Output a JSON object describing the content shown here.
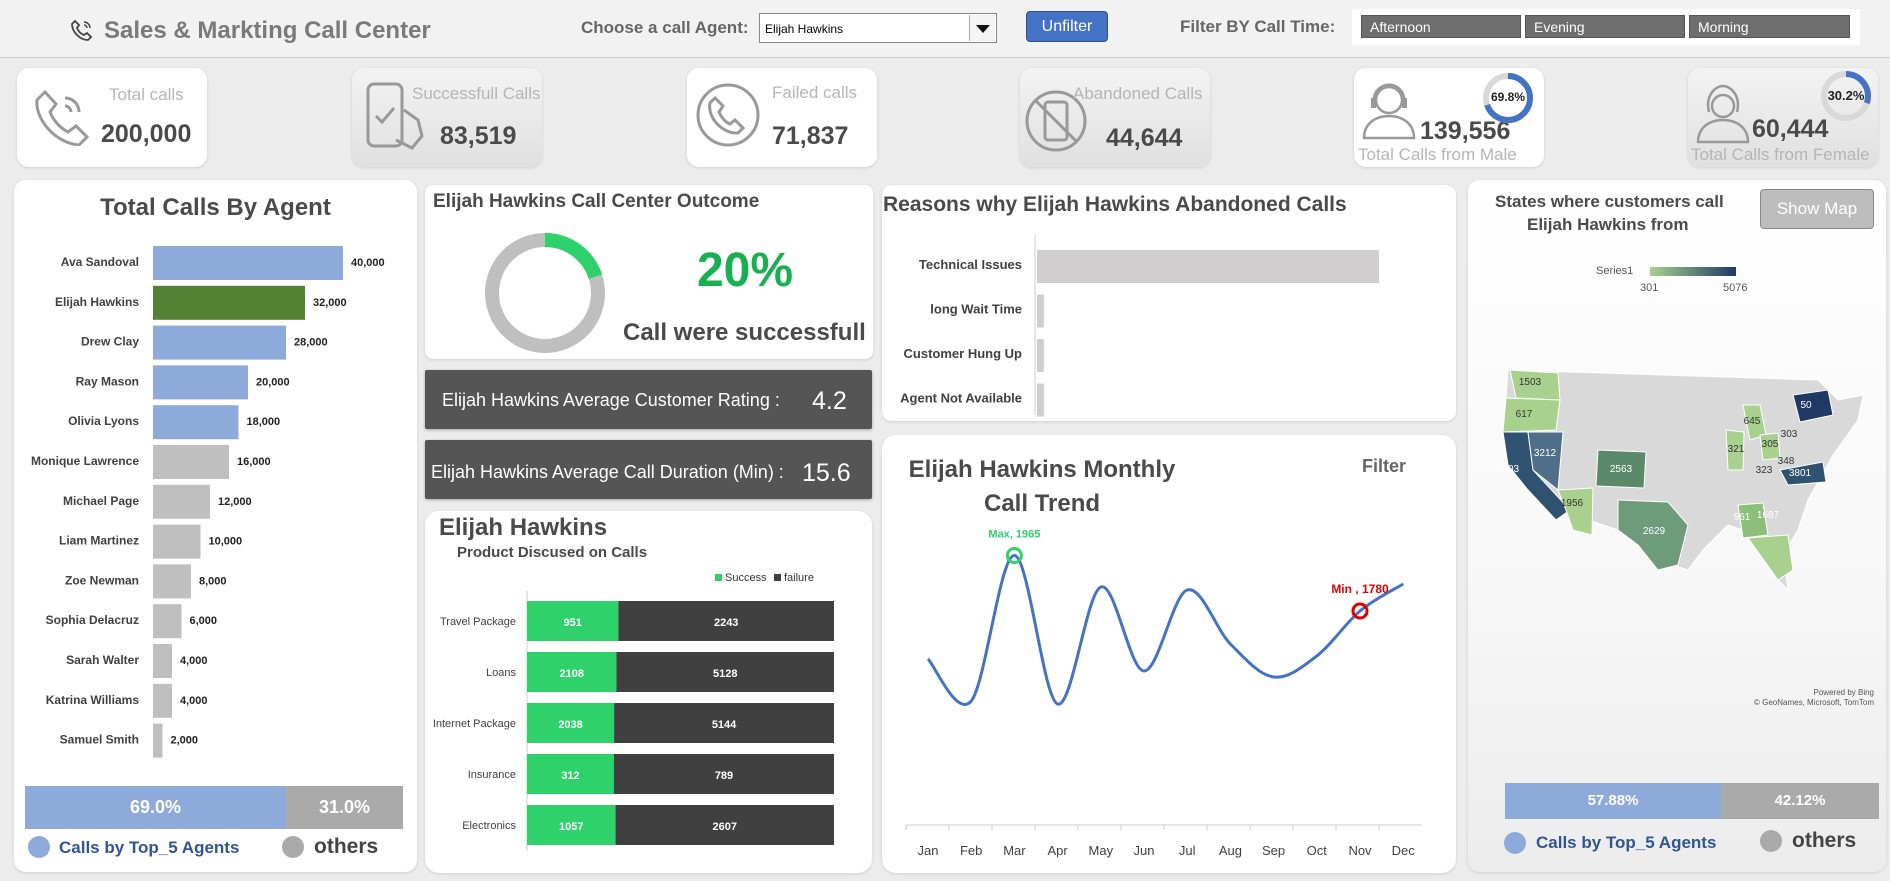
{
  "header": {
    "title": "Sales & Markting Call Center",
    "agent_label": "Choose a call Agent:",
    "agent_value": "Elijah Hawkins",
    "unfilter": "Unfilter",
    "time_label": "Filter BY Call Time:",
    "time_filters": [
      "Afternoon",
      "Evening",
      "Morning"
    ]
  },
  "kpis": {
    "total": {
      "label": "Total calls",
      "value": "200,000"
    },
    "success": {
      "label": "Successfull Calls",
      "value": "83,519"
    },
    "failed": {
      "label": "Failed calls",
      "value": "71,837"
    },
    "abandoned": {
      "label": "Abandoned Calls",
      "value": "44,644"
    },
    "male": {
      "label": "Total Calls from Male",
      "value": "139,556",
      "pct": "69.8%",
      "fraction": 0.698
    },
    "female": {
      "label": "Total Calls from Female",
      "value": "60,444",
      "pct": "30.2%",
      "fraction": 0.302
    }
  },
  "agents_chart": {
    "title": "Total Calls By Agent",
    "bar_colors": {
      "top": "#8eaadb",
      "selected": "#548235",
      "other": "#bfbfbf"
    },
    "items": [
      {
        "name": "Ava Sandoval",
        "value": 40000,
        "label": "40,000",
        "group": "top"
      },
      {
        "name": "Elijah Hawkins",
        "value": 32000,
        "label": "32,000",
        "group": "selected"
      },
      {
        "name": "Drew Clay",
        "value": 28000,
        "label": "28,000",
        "group": "top"
      },
      {
        "name": "Ray Mason",
        "value": 20000,
        "label": "20,000",
        "group": "top"
      },
      {
        "name": "Olivia Lyons",
        "value": 18000,
        "label": "18,000",
        "group": "top"
      },
      {
        "name": "Monique Lawrence",
        "value": 16000,
        "label": "16,000",
        "group": "other"
      },
      {
        "name": "Michael Page",
        "value": 12000,
        "label": "12,000",
        "group": "other"
      },
      {
        "name": "Liam Martinez",
        "value": 10000,
        "label": "10,000",
        "group": "other"
      },
      {
        "name": "Zoe Newman",
        "value": 8000,
        "label": "8,000",
        "group": "other"
      },
      {
        "name": "Sophia Delacruz",
        "value": 6000,
        "label": "6,000",
        "group": "other"
      },
      {
        "name": "Sarah Walter",
        "value": 4000,
        "label": "4,000",
        "group": "other"
      },
      {
        "name": "Katrina Williams",
        "value": 4000,
        "label": "4,000",
        "group": "other"
      },
      {
        "name": "Samuel Smith",
        "value": 2000,
        "label": "2,000",
        "group": "other"
      }
    ],
    "split": {
      "top": "69.0%",
      "top_fraction": 0.69,
      "others": "31.0%",
      "top_label": "Calls by Top_5 Agents",
      "others_label": "others"
    }
  },
  "outcome": {
    "title": "Elijah Hawkins Call Center Outcome",
    "pct": "20%",
    "fraction": 0.2,
    "subtitle": "Call were successfull"
  },
  "rating": {
    "label": "Elijah Hawkins  Average Customer Rating :",
    "value": "4.2"
  },
  "duration": {
    "label": "Elijah Hawkins  Average Call Duration (Min) :",
    "value": "15.6"
  },
  "chart_data": [
    {
      "type": "bar",
      "title": "Elijah Hawkins",
      "subtitle": "Product Discused on Calls",
      "categories": [
        "Travel Package",
        "Loans",
        "Internet Package",
        "Insurance",
        "Electronics"
      ],
      "series": [
        {
          "name": "Success",
          "values": [
            951,
            2108,
            2038,
            312,
            1057
          ],
          "color": "#2ed16a"
        },
        {
          "name": "failure",
          "values": [
            2243,
            5128,
            5144,
            789,
            2607
          ],
          "color": "#404040"
        }
      ],
      "stacked": "percent",
      "legend": "top-right"
    },
    {
      "type": "bar",
      "title": "Reasons why Elijah Hawkins Abandoned Calls",
      "categories": [
        "Technical Issues",
        "long Wait Time",
        "Customer Hung Up",
        "Agent Not Available"
      ],
      "values": [
        100,
        2,
        2,
        2
      ]
    },
    {
      "type": "line",
      "title": "Elijah Hawkins Monthly Call Trend",
      "filter_label": "Filter",
      "x": [
        "Jan",
        "Feb",
        "Mar",
        "Apr",
        "May",
        "Jun",
        "Jul",
        "Aug",
        "Sep",
        "Oct",
        "Nov",
        "Dec"
      ],
      "values": [
        1620,
        1480,
        1965,
        1470,
        1860,
        1580,
        1850,
        1670,
        1560,
        1630,
        1780,
        1870
      ],
      "max_label": "Max, 1965",
      "min_label": "Min , 1780",
      "min_index": 10,
      "max_index": 2
    }
  ],
  "map": {
    "title1": "States where customers call",
    "title2": "Elijah Hawkins from",
    "button": "Show Map",
    "legend_series": "Series1",
    "legend_min": "301",
    "legend_max": "5076",
    "credit1": "Powered by Bing",
    "credit2": "© GeoNames, Microsoft, TomTom",
    "values": [
      "1503",
      "617",
      "3212",
      "3803",
      "1956",
      "2563",
      "2629",
      "645",
      "305",
      "303",
      "321",
      "323",
      "348",
      "50",
      "3801",
      "961",
      "1687"
    ],
    "split": {
      "top": "57.88%",
      "top_fraction": 0.5788,
      "others": "42.12%",
      "top_label": "Calls by Top_5 Agents",
      "others_label": "others"
    }
  }
}
